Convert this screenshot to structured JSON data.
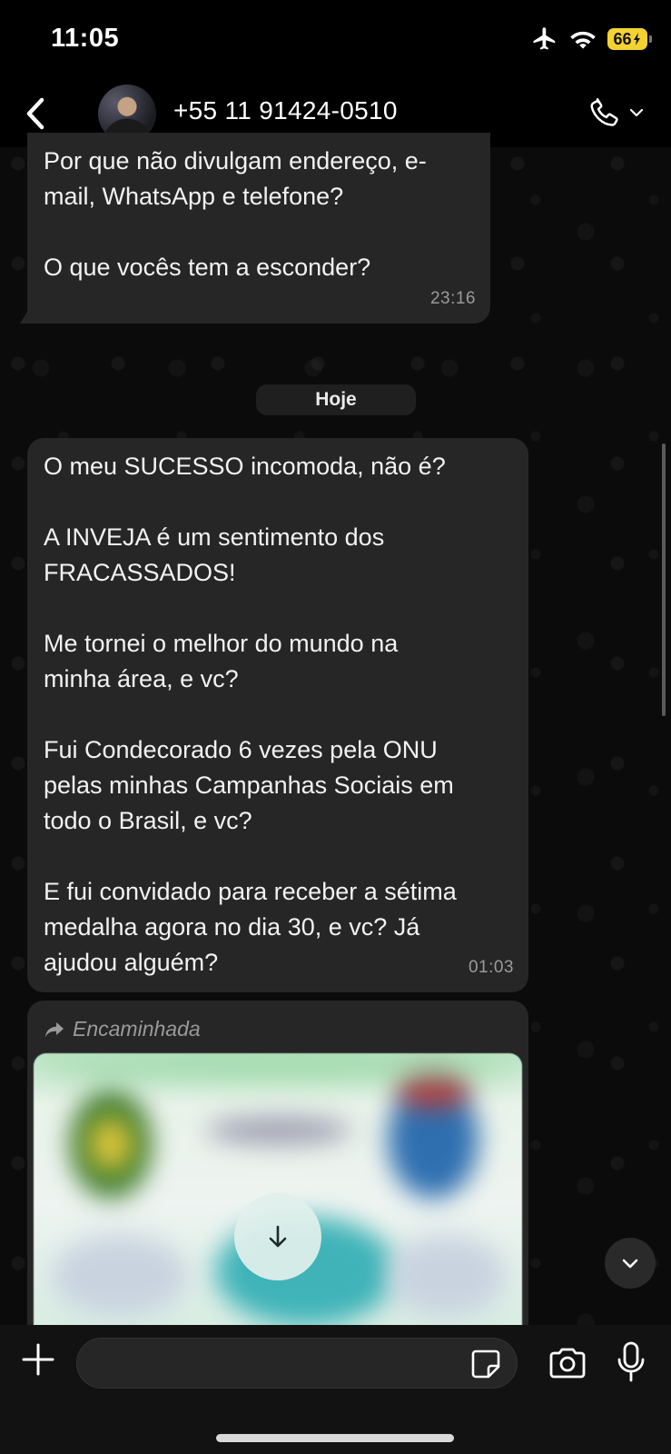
{
  "status_bar": {
    "time": "11:05",
    "battery": "66"
  },
  "header": {
    "contact": "+55 11 91424-0510"
  },
  "messages": [
    {
      "text": "Por que não divulgam endereço, e-\nmail, WhatsApp e telefone?\n\nO que vocês tem a esconder?",
      "time": "23:16"
    },
    {
      "text": "O meu SUCESSO incomoda, não é?\n\nA INVEJA é um sentimento dos\nFRACASSADOS!\n\nMe tornei o melhor do mundo na\nminha área, e vc?\n\nFui Condecorado 6 vezes pela ONU\npelas minhas Campanhas Sociais em\ntodo o Brasil, e vc?\n\nE fui convidado para receber a sétima\nmedalha agora no dia 30, e vc? Já\najudou alguém?",
      "time": "01:03"
    }
  ],
  "date_divider": "Hoje",
  "forwarded": {
    "label": "Encaminhada"
  },
  "input": {
    "value": ""
  },
  "colors": {
    "bubble": "#262626",
    "background": "#0b0b0b",
    "battery": "#f3d232"
  },
  "icons": [
    "back-icon",
    "phone-icon",
    "chevron-down-icon",
    "forward-arrow-icon",
    "download-icon",
    "plus-icon",
    "sticker-icon",
    "camera-icon",
    "mic-icon",
    "airplane-icon",
    "wifi-icon",
    "battery-icon"
  ]
}
